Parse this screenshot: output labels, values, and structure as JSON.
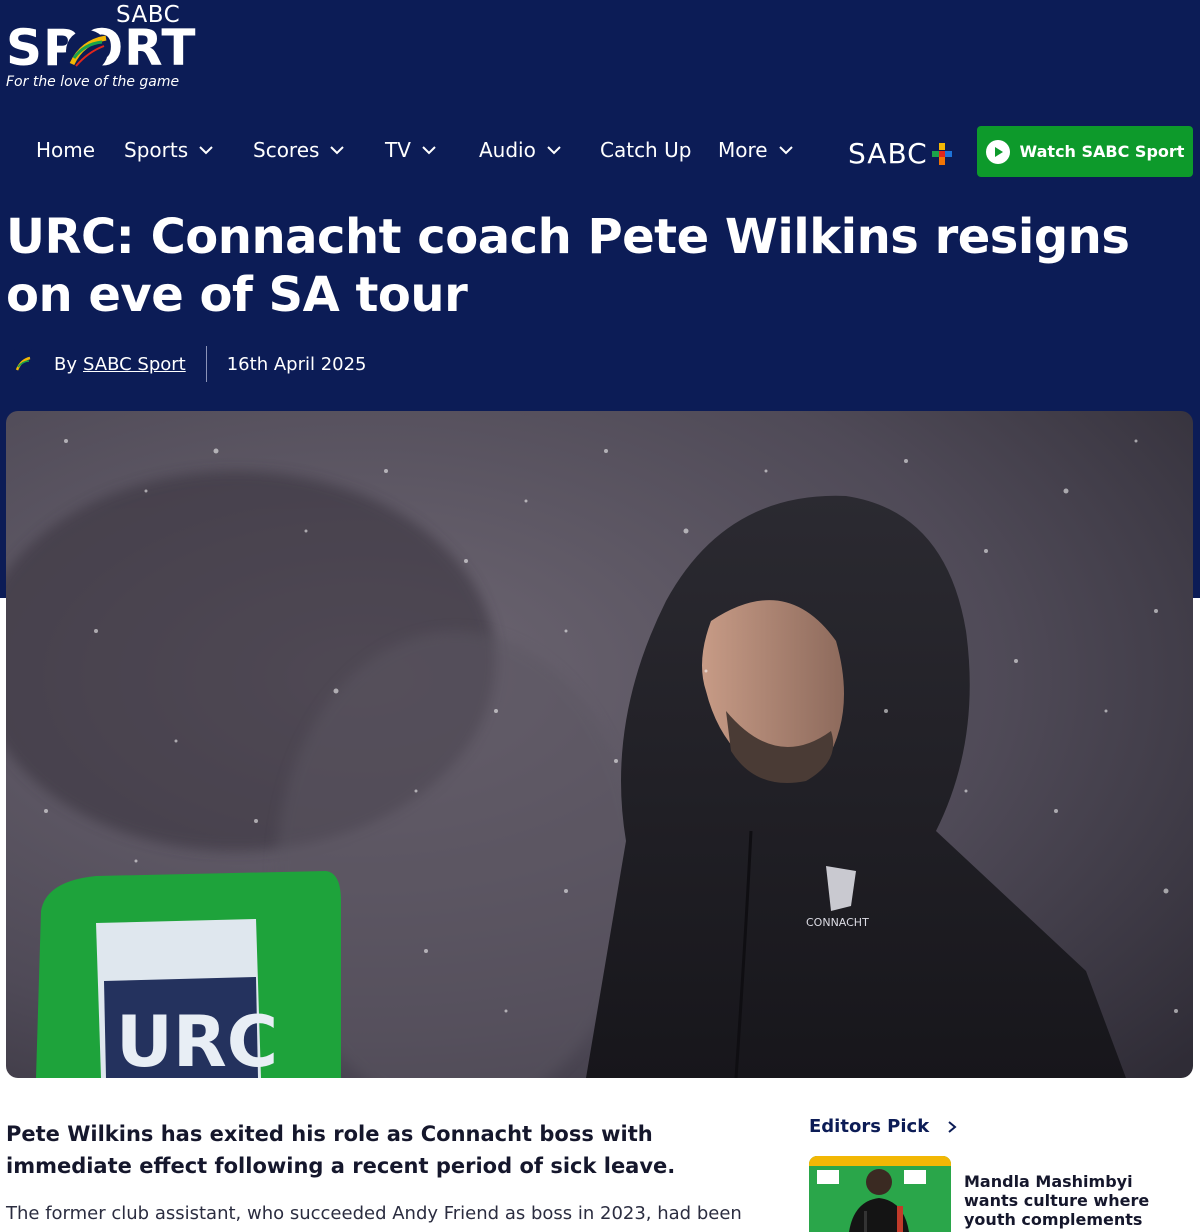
{
  "brand": {
    "logo_top": "SABC",
    "logo_main": "SPORT",
    "tagline": "For the love of the game"
  },
  "nav": {
    "items": [
      {
        "label": "Home",
        "has_dropdown": false
      },
      {
        "label": "Sports",
        "has_dropdown": true
      },
      {
        "label": "Scores",
        "has_dropdown": true
      },
      {
        "label": "TV",
        "has_dropdown": true
      },
      {
        "label": "Audio",
        "has_dropdown": true
      },
      {
        "label": "Catch Up",
        "has_dropdown": false
      },
      {
        "label": "More",
        "has_dropdown": true
      }
    ],
    "sabc_plus": "SABC",
    "watch_button": "Watch SABC Sport"
  },
  "article": {
    "title": "URC: Connacht coach Pete Wilkins resigns on eve of SA tour",
    "by_prefix": "By",
    "author": "SABC Sport",
    "date": "16th April 2025",
    "lede": "Pete Wilkins has exited his role as Connacht boss with immediate effect following a recent period of sick leave.",
    "body_first_line": "The former club assistant, who succeeded Andy Friend as boss in 2023, had been absent",
    "hero_sign_text": "URC",
    "jacket_crest_text": "CONNACHT"
  },
  "sidebar": {
    "section_label": "Editors Pick",
    "card_title": "Mandla Mashimbyi wants culture where youth complements experience"
  },
  "colors": {
    "header_bg": "#0c1c56",
    "accent_green": "#0d9a2b",
    "text_dark": "#15172c"
  },
  "icons": {
    "nav_dropdown": "chevron-down-icon",
    "watch": "play-icon",
    "editors_pick_arrow": "chevron-right-icon"
  }
}
